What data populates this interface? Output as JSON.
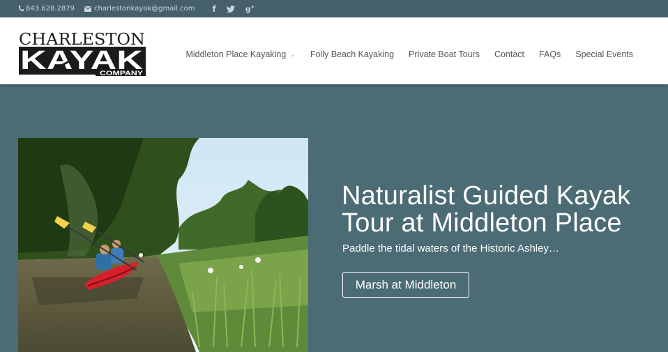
{
  "topbar": {
    "phone": "843.628.2879",
    "email": "charlestonkayak@gmail.com",
    "social_icons": [
      "facebook-icon",
      "twitter-icon",
      "google-plus-icon"
    ]
  },
  "logo": {
    "line1": "CHARLESTON",
    "line2": "KAYAK",
    "line3": "COMPANY"
  },
  "nav": {
    "items": [
      {
        "label": "Middleton Place Kayaking",
        "has_dropdown": true
      },
      {
        "label": "Folly Beach Kayaking"
      },
      {
        "label": "Private Boat Tours"
      },
      {
        "label": "Contact"
      },
      {
        "label": "FAQs"
      },
      {
        "label": "Special Events"
      }
    ],
    "dropdown_glyph": "⌄"
  },
  "hero": {
    "title_line1": "Naturalist Guided Kayak",
    "title_line2": "Tour at Middleton Place",
    "subtitle": "Paddle the tidal waters of the Historic Ashley…",
    "button_label": "Marsh at Middleton",
    "photo_description_icon": "kayak-photo"
  },
  "colors": {
    "topbar_bg": "#45606a",
    "hero_bg": "#4b6b75",
    "header_bg": "#ffffff",
    "kayak_red": "#d8202c"
  }
}
